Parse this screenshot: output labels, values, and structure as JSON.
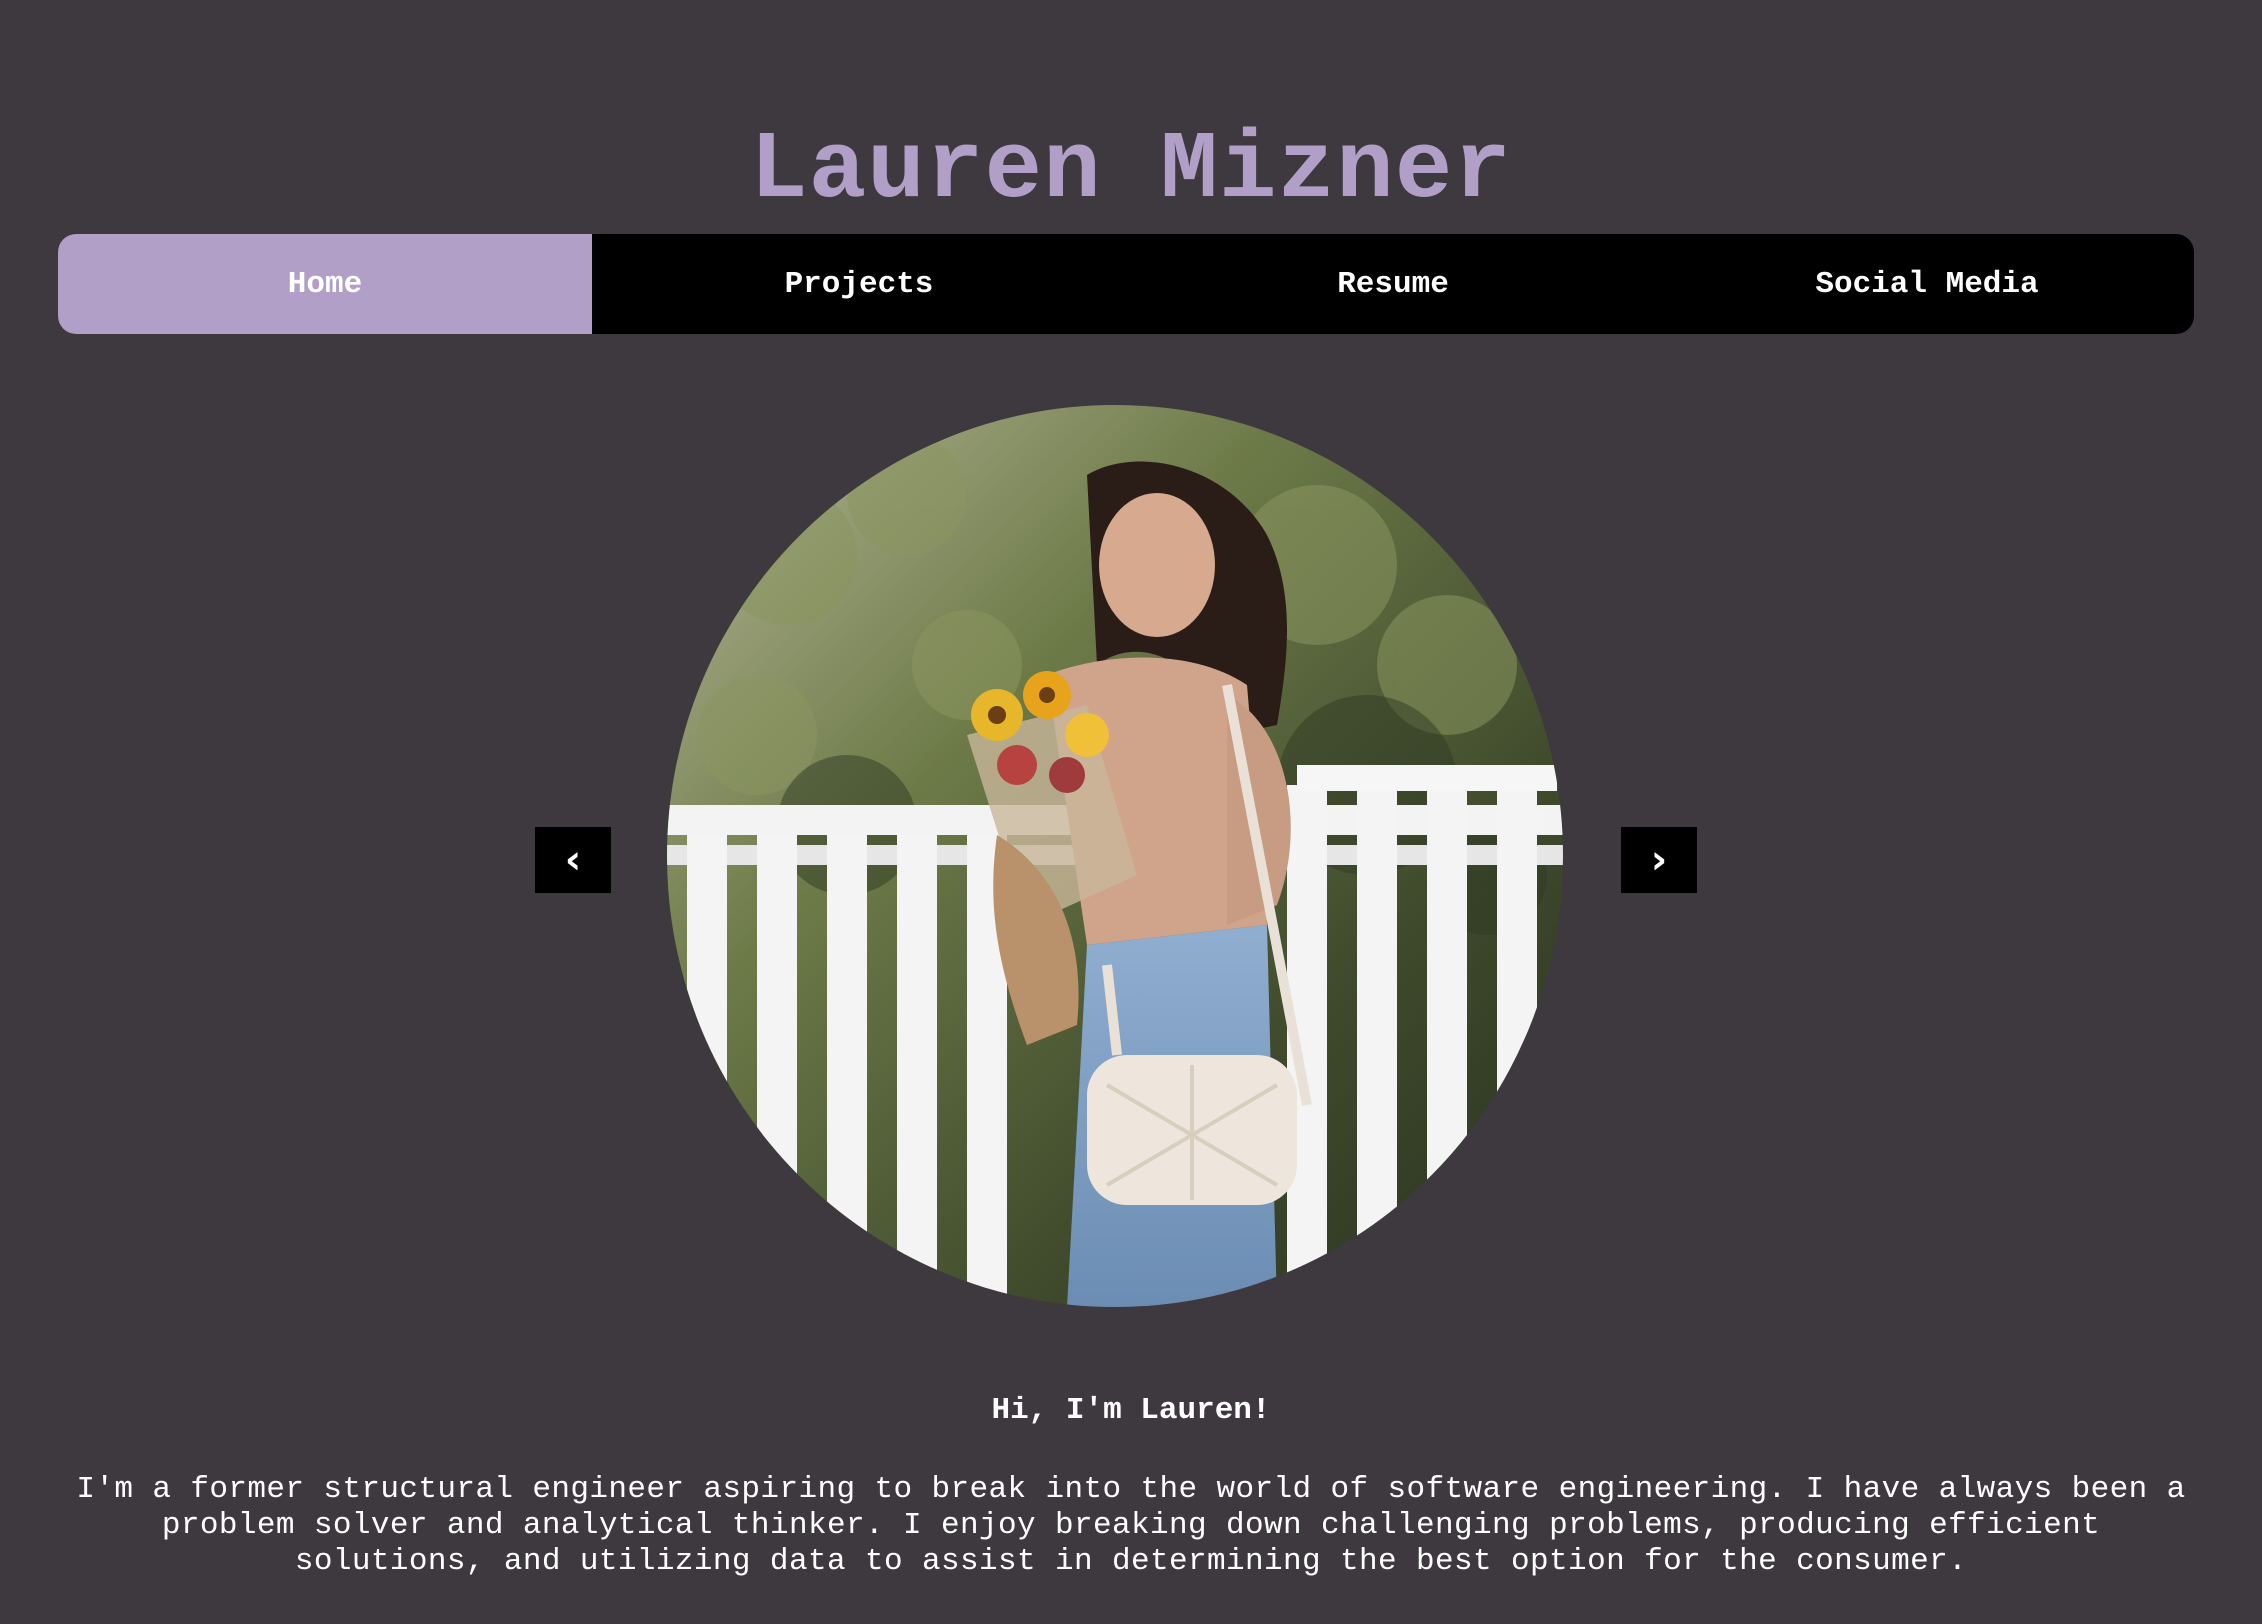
{
  "header": {
    "title": "Lauren Mizner"
  },
  "nav": {
    "items": [
      {
        "label": "Home",
        "active": true
      },
      {
        "label": "Projects",
        "active": false
      },
      {
        "label": "Resume",
        "active": false
      },
      {
        "label": "Social Media",
        "active": false
      }
    ]
  },
  "carousel": {
    "prev_label": "‹",
    "next_label": "›"
  },
  "intro": {
    "greeting": "Hi, I'm Lauren!",
    "bio": "I'm a former structural engineer aspiring to break into the world of software engineering. I have always been a problem solver and analytical thinker. I enjoy breaking down challenging problems, producing efficient solutions, and utilizing data to assist in determining the best option for the consumer."
  },
  "colors": {
    "background": "#3e393e",
    "accent": "#b19fc8",
    "nav_background": "#000000",
    "text": "#ffffff"
  }
}
